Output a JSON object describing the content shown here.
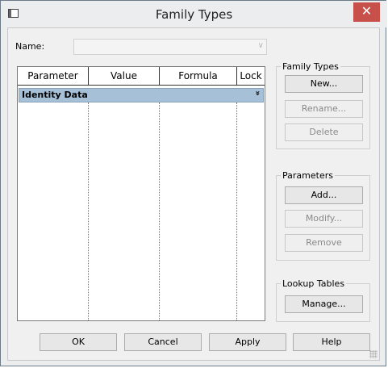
{
  "window": {
    "title": "Family Types",
    "close_glyph": "✕"
  },
  "name_field": {
    "label": "Name:",
    "value": ""
  },
  "grid": {
    "columns": [
      "Parameter",
      "Value",
      "Formula",
      "Lock"
    ],
    "group": {
      "label": "Identity Data",
      "toggle_glyph": "»"
    }
  },
  "family_types": {
    "title": "Family Types",
    "buttons": [
      {
        "label": "New...",
        "enabled": true
      },
      {
        "label": "Rename...",
        "enabled": false
      },
      {
        "label": "Delete",
        "enabled": false
      }
    ]
  },
  "parameters": {
    "title": "Parameters",
    "buttons": [
      {
        "label": "Add...",
        "enabled": true
      },
      {
        "label": "Modify...",
        "enabled": false
      },
      {
        "label": "Remove",
        "enabled": false
      }
    ]
  },
  "lookup_tables": {
    "title": "Lookup Tables",
    "buttons": [
      {
        "label": "Manage...",
        "enabled": true
      }
    ]
  },
  "footer": {
    "ok": "OK",
    "cancel": "Cancel",
    "apply": "Apply",
    "help": "Help"
  }
}
